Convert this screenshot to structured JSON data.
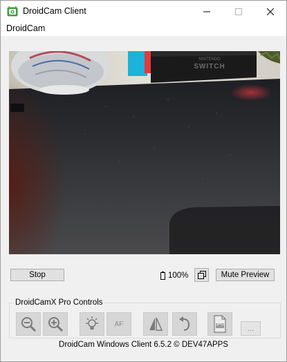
{
  "window": {
    "title": "DroidCam Client",
    "minimize_icon": "minimize-icon",
    "maximize_icon": "maximize-icon",
    "close_icon": "close-icon"
  },
  "menu": {
    "items": [
      "DroidCam"
    ]
  },
  "controls": {
    "stop_label": "Stop",
    "battery_text": "100%",
    "mute_preview_label": "Mute Preview"
  },
  "pro_controls": {
    "group_label": "DroidCamX Pro Controls",
    "buttons": [
      {
        "icon": "zoom-out-icon"
      },
      {
        "icon": "zoom-in-icon"
      },
      {
        "icon": "lightbulb-icon"
      },
      {
        "icon": "autofocus-icon",
        "text": "AF"
      },
      {
        "icon": "mirror-icon"
      },
      {
        "icon": "rotate-icon"
      },
      {
        "icon": "jpg-icon",
        "text": "JPG"
      }
    ],
    "more_label": "..."
  },
  "footer": {
    "text": "DroidCam Windows Client 6.5.2 © DEV47APPS"
  },
  "camera_scene": {
    "console_brand": "NINTENDO",
    "console_model": "SWITCH"
  }
}
